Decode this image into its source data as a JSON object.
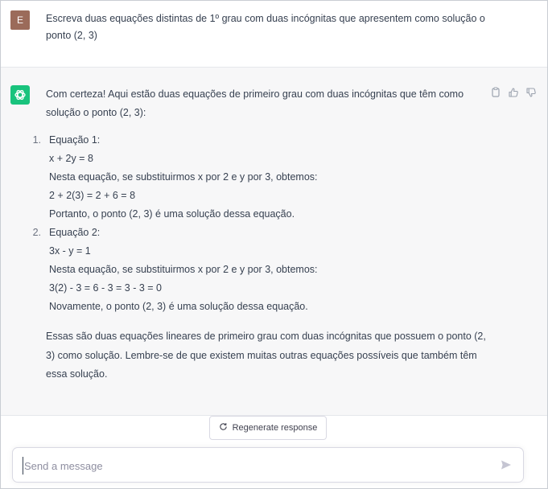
{
  "user": {
    "avatar_letter": "E",
    "message": "Escreva duas equações distintas de 1º grau com duas incógnitas que apresentem como solução o ponto (2, 3)"
  },
  "assistant": {
    "intro": "Com certeza! Aqui estão duas equações de primeiro grau com duas incógnitas que têm como solução o ponto (2, 3):",
    "items": [
      {
        "num": "1.",
        "title": "Equação 1:",
        "lines": [
          "x + 2y = 8",
          "Nesta equação, se substituirmos x por 2 e y por 3, obtemos:",
          "2 + 2(3) = 2 + 6 = 8",
          "Portanto, o ponto (2, 3) é uma solução dessa equação."
        ]
      },
      {
        "num": "2.",
        "title": "Equação 2:",
        "lines": [
          "3x - y = 1",
          "Nesta equação, se substituirmos x por 2 e y por 3, obtemos:",
          "3(2) - 3 = 6 - 3 = 3 - 3 = 0",
          "Novamente, o ponto (2, 3) é uma solução dessa equação."
        ]
      }
    ],
    "outro": "Essas são duas equações lineares de primeiro grau com duas incógnitas que possuem o ponto (2, 3) como solução. Lembre-se de que existem muitas outras equações possíveis que também têm essa solução.",
    "icons": [
      "copy-icon",
      "thumbs-up-icon",
      "thumbs-down-icon"
    ]
  },
  "regenerate_label": "Regenerate response",
  "composer": {
    "placeholder": "Send a message"
  },
  "colors": {
    "bot_avatar": "#19c37d",
    "user_avatar": "#9b6b5a",
    "assistant_bg": "#f7f7f8"
  }
}
